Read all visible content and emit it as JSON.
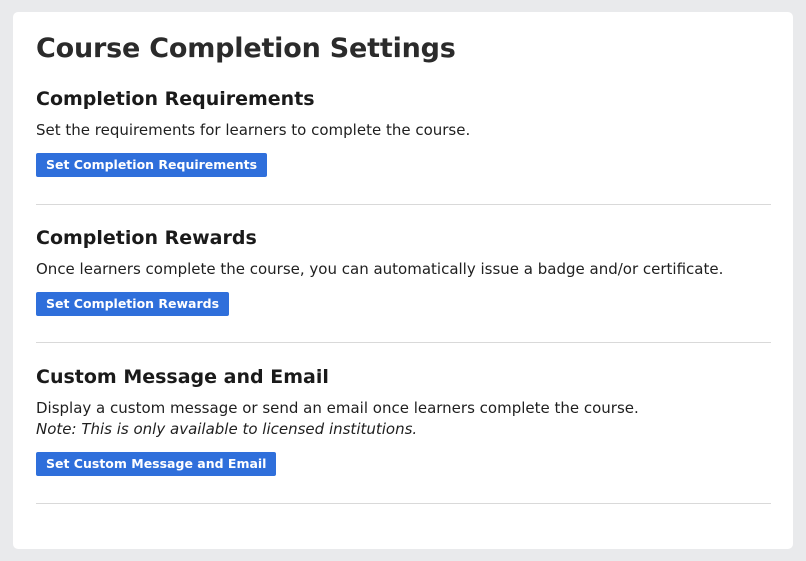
{
  "page": {
    "title": "Course Completion Settings"
  },
  "sections": [
    {
      "heading": "Completion Requirements",
      "description": "Set the requirements for learners to complete the course.",
      "button_label": "Set Completion Requirements"
    },
    {
      "heading": "Completion Rewards",
      "description": "Once learners complete the course, you can automatically issue a badge and/or certificate.",
      "button_label": "Set Completion Rewards"
    },
    {
      "heading": "Custom Message and Email",
      "description": "Display a custom message or send an email once learners complete the course.",
      "note": "Note: This is only available to licensed institutions.",
      "button_label": "Set Custom Message and Email"
    }
  ],
  "colors": {
    "button": "#2f6fdb",
    "background": "#e9eaec",
    "card": "#ffffff",
    "divider": "#d9d9d9"
  }
}
